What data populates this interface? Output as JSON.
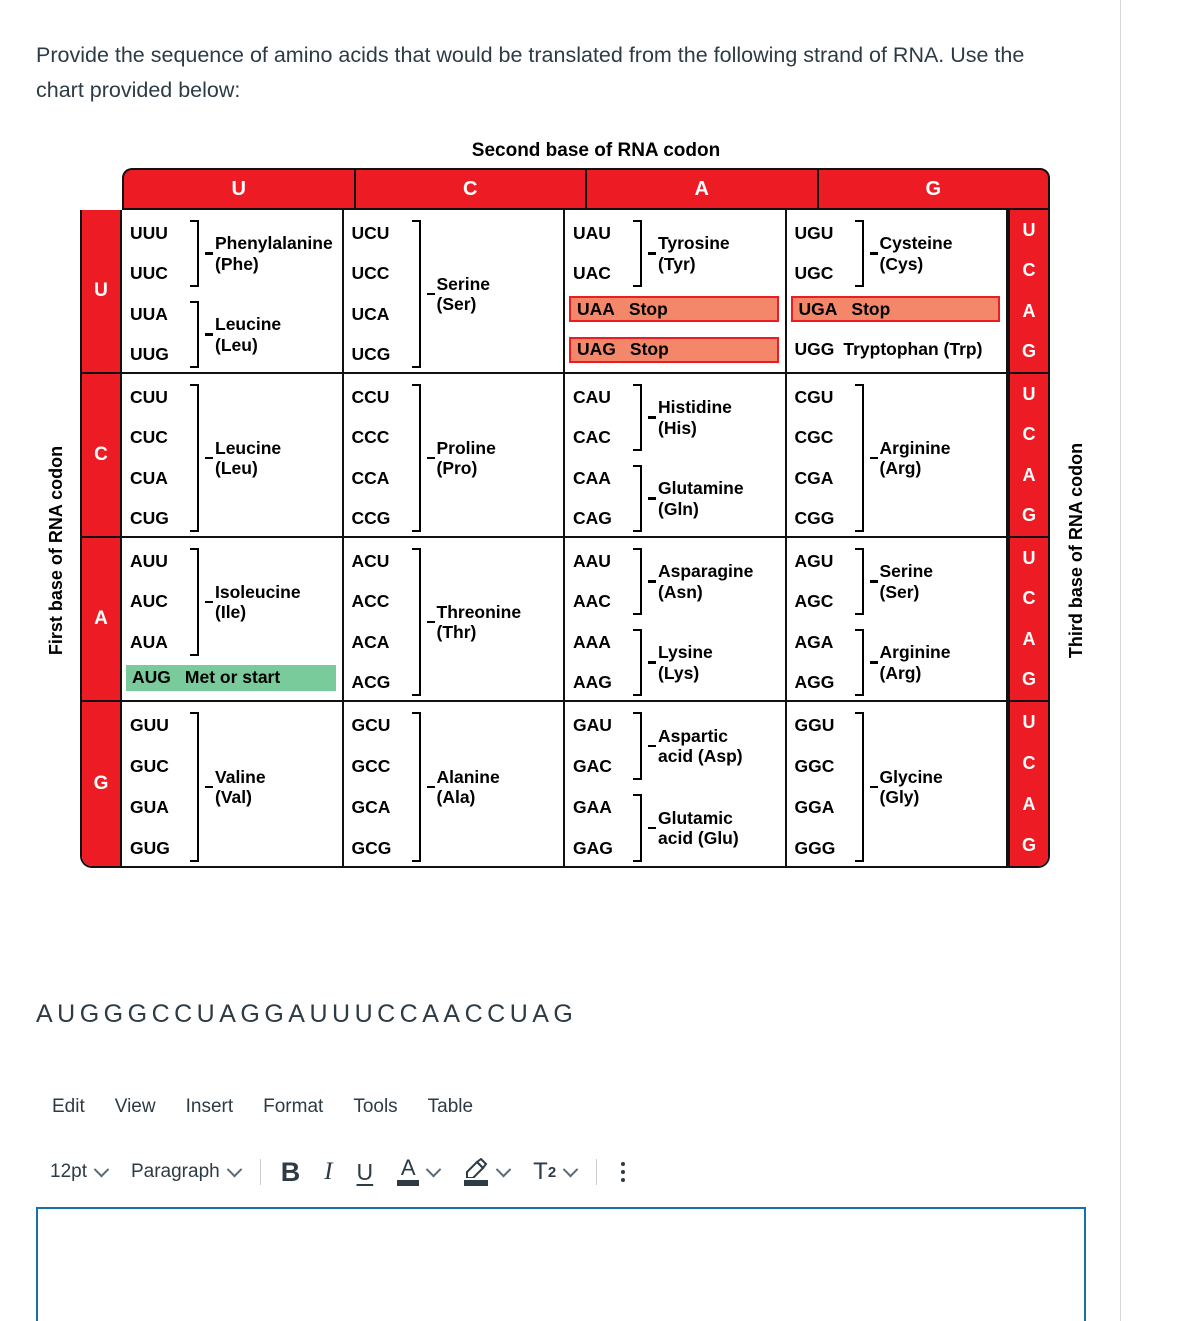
{
  "prompt": "Provide the sequence of amino acids that would be translated from the following strand of RNA. Use the chart provided below:",
  "chart": {
    "title": "Second base of RNA codon",
    "left_axis": "First base of RNA codon",
    "right_axis": "Third base of RNA codon",
    "second_base_headers": [
      "U",
      "C",
      "A",
      "G"
    ],
    "first_bases": [
      "U",
      "C",
      "A",
      "G"
    ],
    "third_bases": [
      "U",
      "C",
      "A",
      "G"
    ],
    "colors": {
      "header_red": "#ED1C24",
      "stop_highlight": "#F4866A",
      "stop_border": "#ED1C24",
      "start_highlight": "#7ACB9C",
      "border": "#111111"
    },
    "rows": [
      {
        "first_base": "U",
        "cells": [
          {
            "codons": [
              "UUU",
              "UUC",
              "UUA",
              "UUG"
            ],
            "groups": [
              {
                "codons": [
                  "UUU",
                  "UUC"
                ],
                "name": "Phenylalanine\n(Phe)"
              },
              {
                "codons": [
                  "UUA",
                  "UUG"
                ],
                "name": "Leucine\n(Leu)"
              }
            ]
          },
          {
            "codons": [
              "UCU",
              "UCC",
              "UCA",
              "UCG"
            ],
            "groups": [
              {
                "codons": [
                  "UCU",
                  "UCC",
                  "UCA",
                  "UCG"
                ],
                "name": "Serine\n(Ser)"
              }
            ]
          },
          {
            "codons": [
              "UAU",
              "UAC"
            ],
            "groups": [
              {
                "codons": [
                  "UAU",
                  "UAC"
                ],
                "name": "Tyrosine\n(Tyr)"
              }
            ],
            "specials": [
              {
                "codon": "UAA",
                "label": "Stop",
                "style": "stop"
              },
              {
                "codon": "UAG",
                "label": "Stop",
                "style": "stop"
              }
            ]
          },
          {
            "codons": [
              "UGU",
              "UGC"
            ],
            "groups": [
              {
                "codons": [
                  "UGU",
                  "UGC"
                ],
                "name": "Cysteine\n(Cys)"
              }
            ],
            "specials": [
              {
                "codon": "UGA",
                "label": "Stop",
                "style": "stop"
              },
              {
                "codon": "UGG",
                "label": "Tryptophan (Trp)",
                "style": "plain"
              }
            ]
          }
        ]
      },
      {
        "first_base": "C",
        "cells": [
          {
            "codons": [
              "CUU",
              "CUC",
              "CUA",
              "CUG"
            ],
            "groups": [
              {
                "codons": [
                  "CUU",
                  "CUC",
                  "CUA",
                  "CUG"
                ],
                "name": "Leucine\n(Leu)"
              }
            ]
          },
          {
            "codons": [
              "CCU",
              "CCC",
              "CCA",
              "CCG"
            ],
            "groups": [
              {
                "codons": [
                  "CCU",
                  "CCC",
                  "CCA",
                  "CCG"
                ],
                "name": "Proline\n(Pro)"
              }
            ]
          },
          {
            "codons": [
              "CAU",
              "CAC",
              "CAA",
              "CAG"
            ],
            "groups": [
              {
                "codons": [
                  "CAU",
                  "CAC"
                ],
                "name": "Histidine\n(His)"
              },
              {
                "codons": [
                  "CAA",
                  "CAG"
                ],
                "name": "Glutamine\n(Gln)"
              }
            ]
          },
          {
            "codons": [
              "CGU",
              "CGC",
              "CGA",
              "CGG"
            ],
            "groups": [
              {
                "codons": [
                  "CGU",
                  "CGC",
                  "CGA",
                  "CGG"
                ],
                "name": "Arginine\n(Arg)"
              }
            ]
          }
        ]
      },
      {
        "first_base": "A",
        "cells": [
          {
            "codons": [
              "AUU",
              "AUC",
              "AUA"
            ],
            "groups": [
              {
                "codons": [
                  "AUU",
                  "AUC",
                  "AUA"
                ],
                "name": "Isoleucine\n(Ile)"
              }
            ],
            "specials": [
              {
                "codon": "AUG",
                "label": "Met or start",
                "style": "start"
              }
            ]
          },
          {
            "codons": [
              "ACU",
              "ACC",
              "ACA",
              "ACG"
            ],
            "groups": [
              {
                "codons": [
                  "ACU",
                  "ACC",
                  "ACA",
                  "ACG"
                ],
                "name": "Threonine\n(Thr)"
              }
            ]
          },
          {
            "codons": [
              "AAU",
              "AAC",
              "AAA",
              "AAG"
            ],
            "groups": [
              {
                "codons": [
                  "AAU",
                  "AAC"
                ],
                "name": "Asparagine\n(Asn)"
              },
              {
                "codons": [
                  "AAA",
                  "AAG"
                ],
                "name": "Lysine\n(Lys)"
              }
            ]
          },
          {
            "codons": [
              "AGU",
              "AGC",
              "AGA",
              "AGG"
            ],
            "groups": [
              {
                "codons": [
                  "AGU",
                  "AGC"
                ],
                "name": "Serine\n(Ser)"
              },
              {
                "codons": [
                  "AGA",
                  "AGG"
                ],
                "name": "Arginine\n(Arg)"
              }
            ]
          }
        ]
      },
      {
        "first_base": "G",
        "cells": [
          {
            "codons": [
              "GUU",
              "GUC",
              "GUA",
              "GUG"
            ],
            "groups": [
              {
                "codons": [
                  "GUU",
                  "GUC",
                  "GUA",
                  "GUG"
                ],
                "name": "Valine\n(Val)"
              }
            ]
          },
          {
            "codons": [
              "GCU",
              "GCC",
              "GCA",
              "GCG"
            ],
            "groups": [
              {
                "codons": [
                  "GCU",
                  "GCC",
                  "GCA",
                  "GCG"
                ],
                "name": "Alanine\n(Ala)"
              }
            ]
          },
          {
            "codons": [
              "GAU",
              "GAC",
              "GAA",
              "GAG"
            ],
            "groups": [
              {
                "codons": [
                  "GAU",
                  "GAC"
                ],
                "name": "Aspartic\nacid (Asp)"
              },
              {
                "codons": [
                  "GAA",
                  "GAG"
                ],
                "name": "Glutamic\nacid (Glu)"
              }
            ]
          },
          {
            "codons": [
              "GGU",
              "GGC",
              "GGA",
              "GGG"
            ],
            "groups": [
              {
                "codons": [
                  "GGU",
                  "GGC",
                  "GGA",
                  "GGG"
                ],
                "name": "Glycine\n(Gly)"
              }
            ]
          }
        ]
      }
    ]
  },
  "rna_sequence": "AUGGGCCUAGGAUUUCCAACCUAG",
  "editor": {
    "menus": [
      "Edit",
      "View",
      "Insert",
      "Format",
      "Tools",
      "Table"
    ],
    "font_size": "12pt",
    "block_format": "Paragraph",
    "buttons": [
      {
        "name": "bold",
        "glyph": "B"
      },
      {
        "name": "italic",
        "glyph": "I"
      },
      {
        "name": "underline",
        "glyph": "U"
      },
      {
        "name": "text-color",
        "glyph": "A"
      },
      {
        "name": "highlight-color",
        "glyph": "✎"
      },
      {
        "name": "superscript",
        "glyph": "T"
      },
      {
        "name": "more-options",
        "glyph": "⋮"
      }
    ],
    "answer_text": ""
  }
}
